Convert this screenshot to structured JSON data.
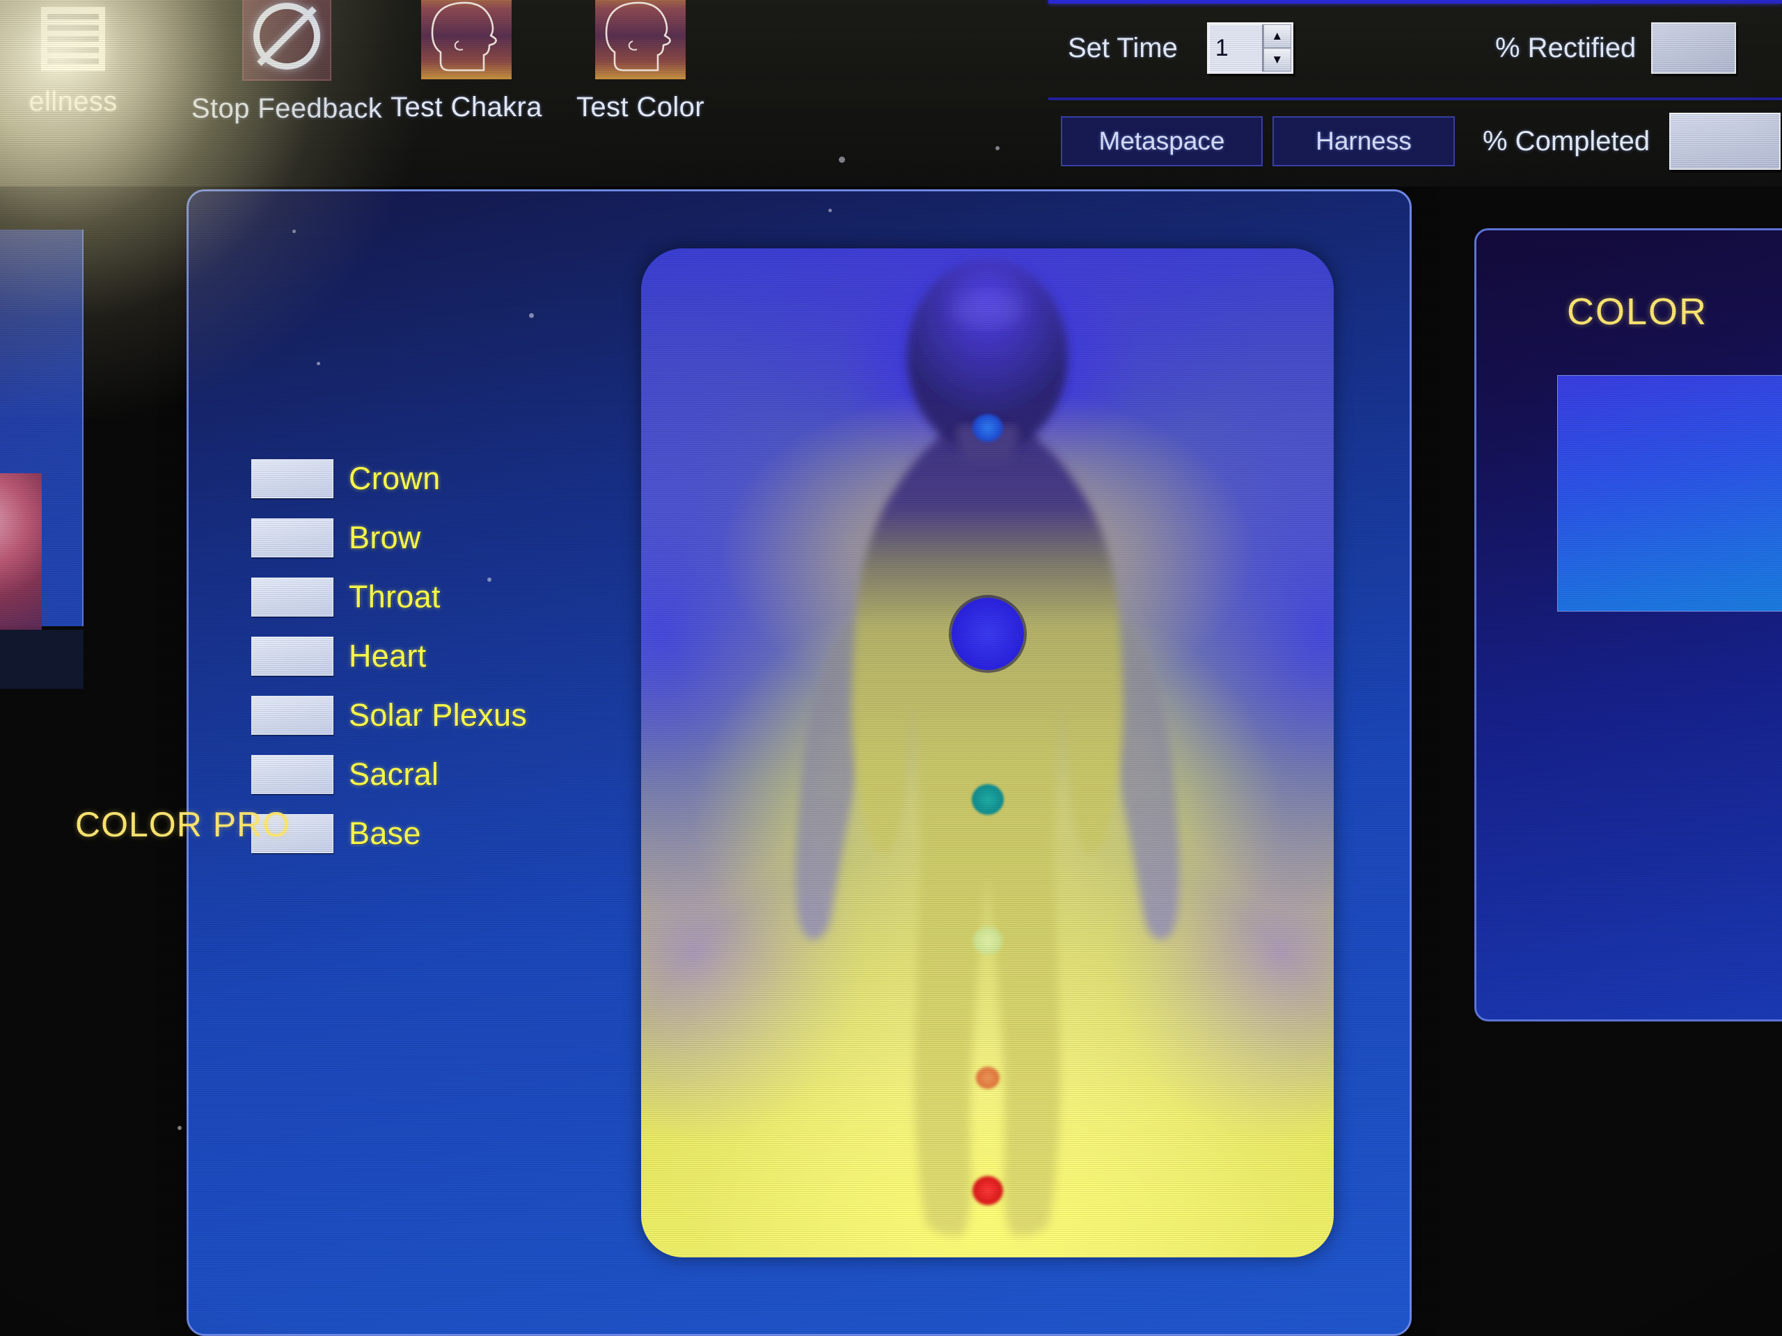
{
  "toolbar": {
    "items": [
      {
        "label": "Wellness",
        "icon": "list-icon",
        "truncated_label": "ellness"
      },
      {
        "label": "Stop Feedback",
        "icon": "no-entry-icon"
      },
      {
        "label": "Test Chakra",
        "icon": "head-profile-icon"
      },
      {
        "label": "Test Color",
        "icon": "head-profile-icon"
      }
    ],
    "set_time": {
      "label": "Set Time",
      "value": "1",
      "up": "▲",
      "down": "▼"
    },
    "pct_rectified": {
      "label": "% Rectified",
      "value": ""
    },
    "pct_completed": {
      "label": "% Completed",
      "value": ""
    },
    "metaspace_button": "Metaspace",
    "harness_button": "Harness"
  },
  "chakra_list": [
    {
      "label": "Crown",
      "swatch": "#e6ecfa"
    },
    {
      "label": "Brow",
      "swatch": "#e6ecfa"
    },
    {
      "label": "Throat",
      "swatch": "#e6ecfa"
    },
    {
      "label": "Heart",
      "swatch": "#e6ecfa"
    },
    {
      "label": "Solar Plexus",
      "swatch": "#e6ecfa"
    },
    {
      "label": "Sacral",
      "swatch": "#e6ecfa"
    },
    {
      "label": "Base",
      "swatch": "#e6ecfa"
    }
  ],
  "aura": {
    "chakra_points": [
      {
        "name": "crown",
        "color": "#3a2fd8",
        "x": 50,
        "y": 10.5,
        "size": 0
      },
      {
        "name": "brow",
        "color": "#2b6ae8",
        "x": 50,
        "y": 24.4,
        "size": 44
      },
      {
        "name": "throat",
        "color": "#2a2ae2",
        "x": 50,
        "y": 39.0,
        "size": 104
      },
      {
        "name": "heart",
        "color": "#139c9c",
        "x": 50,
        "y": 55.8,
        "size": 46
      },
      {
        "name": "solar-plexus",
        "color": "#cfe89a",
        "x": 50,
        "y": 70.0,
        "size": 40
      },
      {
        "name": "sacral",
        "color": "#e87a4a",
        "x": 50,
        "y": 83.0,
        "size": 32
      },
      {
        "name": "base",
        "color": "#e02020",
        "x": 50,
        "y": 94.0,
        "size": 40
      }
    ]
  },
  "color_panel": {
    "title": "COLOR",
    "program_label": "COLOR PRO",
    "swatch_color": "#2c55e8"
  }
}
